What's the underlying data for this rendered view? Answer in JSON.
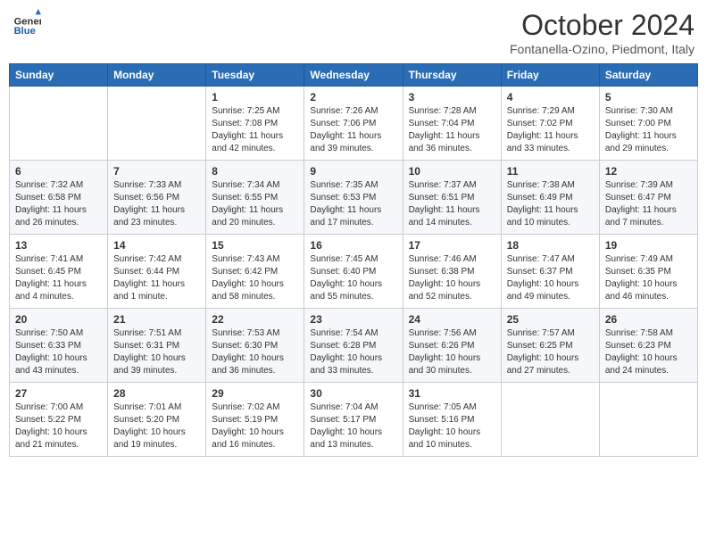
{
  "header": {
    "logo_general": "General",
    "logo_blue": "Blue",
    "month": "October 2024",
    "location": "Fontanella-Ozino, Piedmont, Italy"
  },
  "weekdays": [
    "Sunday",
    "Monday",
    "Tuesday",
    "Wednesday",
    "Thursday",
    "Friday",
    "Saturday"
  ],
  "weeks": [
    [
      {
        "day": "",
        "sunrise": "",
        "sunset": "",
        "daylight": ""
      },
      {
        "day": "",
        "sunrise": "",
        "sunset": "",
        "daylight": ""
      },
      {
        "day": "1",
        "sunrise": "Sunrise: 7:25 AM",
        "sunset": "Sunset: 7:08 PM",
        "daylight": "Daylight: 11 hours and 42 minutes."
      },
      {
        "day": "2",
        "sunrise": "Sunrise: 7:26 AM",
        "sunset": "Sunset: 7:06 PM",
        "daylight": "Daylight: 11 hours and 39 minutes."
      },
      {
        "day": "3",
        "sunrise": "Sunrise: 7:28 AM",
        "sunset": "Sunset: 7:04 PM",
        "daylight": "Daylight: 11 hours and 36 minutes."
      },
      {
        "day": "4",
        "sunrise": "Sunrise: 7:29 AM",
        "sunset": "Sunset: 7:02 PM",
        "daylight": "Daylight: 11 hours and 33 minutes."
      },
      {
        "day": "5",
        "sunrise": "Sunrise: 7:30 AM",
        "sunset": "Sunset: 7:00 PM",
        "daylight": "Daylight: 11 hours and 29 minutes."
      }
    ],
    [
      {
        "day": "6",
        "sunrise": "Sunrise: 7:32 AM",
        "sunset": "Sunset: 6:58 PM",
        "daylight": "Daylight: 11 hours and 26 minutes."
      },
      {
        "day": "7",
        "sunrise": "Sunrise: 7:33 AM",
        "sunset": "Sunset: 6:56 PM",
        "daylight": "Daylight: 11 hours and 23 minutes."
      },
      {
        "day": "8",
        "sunrise": "Sunrise: 7:34 AM",
        "sunset": "Sunset: 6:55 PM",
        "daylight": "Daylight: 11 hours and 20 minutes."
      },
      {
        "day": "9",
        "sunrise": "Sunrise: 7:35 AM",
        "sunset": "Sunset: 6:53 PM",
        "daylight": "Daylight: 11 hours and 17 minutes."
      },
      {
        "day": "10",
        "sunrise": "Sunrise: 7:37 AM",
        "sunset": "Sunset: 6:51 PM",
        "daylight": "Daylight: 11 hours and 14 minutes."
      },
      {
        "day": "11",
        "sunrise": "Sunrise: 7:38 AM",
        "sunset": "Sunset: 6:49 PM",
        "daylight": "Daylight: 11 hours and 10 minutes."
      },
      {
        "day": "12",
        "sunrise": "Sunrise: 7:39 AM",
        "sunset": "Sunset: 6:47 PM",
        "daylight": "Daylight: 11 hours and 7 minutes."
      }
    ],
    [
      {
        "day": "13",
        "sunrise": "Sunrise: 7:41 AM",
        "sunset": "Sunset: 6:45 PM",
        "daylight": "Daylight: 11 hours and 4 minutes."
      },
      {
        "day": "14",
        "sunrise": "Sunrise: 7:42 AM",
        "sunset": "Sunset: 6:44 PM",
        "daylight": "Daylight: 11 hours and 1 minute."
      },
      {
        "day": "15",
        "sunrise": "Sunrise: 7:43 AM",
        "sunset": "Sunset: 6:42 PM",
        "daylight": "Daylight: 10 hours and 58 minutes."
      },
      {
        "day": "16",
        "sunrise": "Sunrise: 7:45 AM",
        "sunset": "Sunset: 6:40 PM",
        "daylight": "Daylight: 10 hours and 55 minutes."
      },
      {
        "day": "17",
        "sunrise": "Sunrise: 7:46 AM",
        "sunset": "Sunset: 6:38 PM",
        "daylight": "Daylight: 10 hours and 52 minutes."
      },
      {
        "day": "18",
        "sunrise": "Sunrise: 7:47 AM",
        "sunset": "Sunset: 6:37 PM",
        "daylight": "Daylight: 10 hours and 49 minutes."
      },
      {
        "day": "19",
        "sunrise": "Sunrise: 7:49 AM",
        "sunset": "Sunset: 6:35 PM",
        "daylight": "Daylight: 10 hours and 46 minutes."
      }
    ],
    [
      {
        "day": "20",
        "sunrise": "Sunrise: 7:50 AM",
        "sunset": "Sunset: 6:33 PM",
        "daylight": "Daylight: 10 hours and 43 minutes."
      },
      {
        "day": "21",
        "sunrise": "Sunrise: 7:51 AM",
        "sunset": "Sunset: 6:31 PM",
        "daylight": "Daylight: 10 hours and 39 minutes."
      },
      {
        "day": "22",
        "sunrise": "Sunrise: 7:53 AM",
        "sunset": "Sunset: 6:30 PM",
        "daylight": "Daylight: 10 hours and 36 minutes."
      },
      {
        "day": "23",
        "sunrise": "Sunrise: 7:54 AM",
        "sunset": "Sunset: 6:28 PM",
        "daylight": "Daylight: 10 hours and 33 minutes."
      },
      {
        "day": "24",
        "sunrise": "Sunrise: 7:56 AM",
        "sunset": "Sunset: 6:26 PM",
        "daylight": "Daylight: 10 hours and 30 minutes."
      },
      {
        "day": "25",
        "sunrise": "Sunrise: 7:57 AM",
        "sunset": "Sunset: 6:25 PM",
        "daylight": "Daylight: 10 hours and 27 minutes."
      },
      {
        "day": "26",
        "sunrise": "Sunrise: 7:58 AM",
        "sunset": "Sunset: 6:23 PM",
        "daylight": "Daylight: 10 hours and 24 minutes."
      }
    ],
    [
      {
        "day": "27",
        "sunrise": "Sunrise: 7:00 AM",
        "sunset": "Sunset: 5:22 PM",
        "daylight": "Daylight: 10 hours and 21 minutes."
      },
      {
        "day": "28",
        "sunrise": "Sunrise: 7:01 AM",
        "sunset": "Sunset: 5:20 PM",
        "daylight": "Daylight: 10 hours and 19 minutes."
      },
      {
        "day": "29",
        "sunrise": "Sunrise: 7:02 AM",
        "sunset": "Sunset: 5:19 PM",
        "daylight": "Daylight: 10 hours and 16 minutes."
      },
      {
        "day": "30",
        "sunrise": "Sunrise: 7:04 AM",
        "sunset": "Sunset: 5:17 PM",
        "daylight": "Daylight: 10 hours and 13 minutes."
      },
      {
        "day": "31",
        "sunrise": "Sunrise: 7:05 AM",
        "sunset": "Sunset: 5:16 PM",
        "daylight": "Daylight: 10 hours and 10 minutes."
      },
      {
        "day": "",
        "sunrise": "",
        "sunset": "",
        "daylight": ""
      },
      {
        "day": "",
        "sunrise": "",
        "sunset": "",
        "daylight": ""
      }
    ]
  ]
}
